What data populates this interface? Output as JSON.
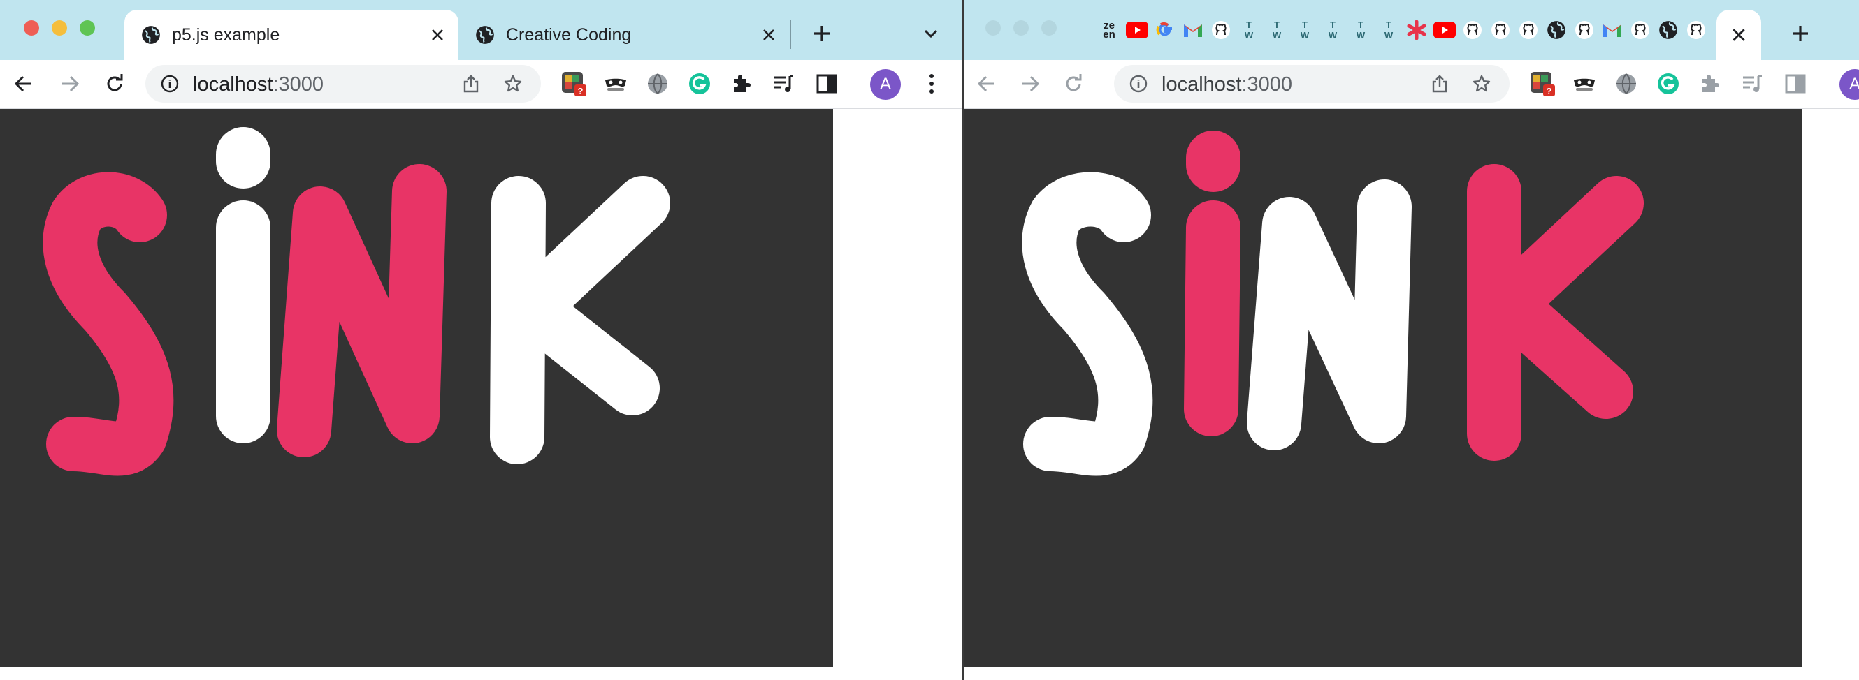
{
  "colors": {
    "pink": "#e83466",
    "white": "#ffffff",
    "canvas_bg": "#333333",
    "tabstrip": "#c0e5ef"
  },
  "left_window": {
    "tabs": [
      {
        "title": "p5.js example",
        "icon": "globe-icon",
        "active": true
      },
      {
        "title": "Creative Coding",
        "icon": "globe-icon",
        "active": false
      }
    ],
    "url_host": "localhost",
    "url_port": ":3000",
    "profile_initial": "A",
    "canvas_letters": [
      {
        "char": "S",
        "color": "pink"
      },
      {
        "char": "i",
        "color": "white"
      },
      {
        "char": "N",
        "color": "pink"
      },
      {
        "char": "K",
        "color": "white"
      }
    ]
  },
  "right_window": {
    "pinned_tabs": [
      "zen-icon",
      "youtube-icon",
      "google-icon",
      "gmail-icon",
      "github-icon",
      "tw-icon",
      "tw-icon",
      "tw-icon",
      "tw-icon",
      "tw-icon",
      "tw-icon",
      "asterisk-icon",
      "youtube-icon",
      "github-icon",
      "github-icon",
      "github-icon",
      "globe-icon",
      "github-icon",
      "gmail-icon",
      "github-icon",
      "globe-icon",
      "github-icon"
    ],
    "zen_text": "ze\nen",
    "tw_text": "T\nW",
    "url_host": "localhost",
    "url_port": ":3000",
    "profile_initial": "A",
    "canvas_letters": [
      {
        "char": "S",
        "color": "white"
      },
      {
        "char": "i",
        "color": "pink"
      },
      {
        "char": "N",
        "color": "white"
      },
      {
        "char": "K",
        "color": "pink"
      }
    ]
  }
}
